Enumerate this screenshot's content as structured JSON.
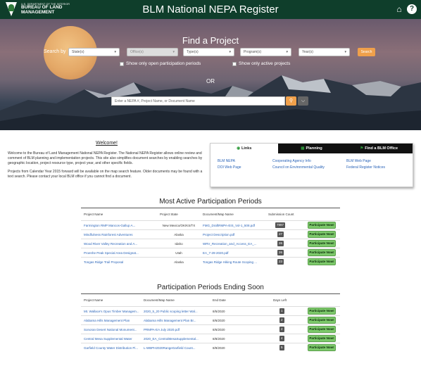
{
  "header": {
    "logo_line1": "U.S. DEPARTMENT OF THE INTERIOR",
    "logo_line2": "BUREAU OF LAND",
    "logo_line3": "MANAGEMENT",
    "title": "BLM National NEPA Register",
    "icons": [
      "home-icon",
      "help-icon"
    ]
  },
  "hero": {
    "title": "Find a Project",
    "search_by_label": "Search by",
    "filters": [
      {
        "label": "State(s)",
        "disabled": false
      },
      {
        "label": "Office(s)",
        "disabled": true
      },
      {
        "label": "Type(s)",
        "disabled": false
      },
      {
        "label": "Program(s)",
        "disabled": false
      },
      {
        "label": "Year(s)",
        "disabled": false
      }
    ],
    "search_button": "Search",
    "checkbox_open": "Show only open participation periods",
    "checkbox_active": "Show only active projects",
    "or_label": "OR",
    "keyword_placeholder": "Enter a NEPA #, Project Name, or Document Name"
  },
  "welcome": {
    "title": "Welcome!",
    "paragraph1": "Welcome to the Bureau of Land Management National NEPA Register. The National NEPA Register allows online review and comment of BLM planning and implementation projects. This site also simplifies document searches by enabling searches by geographic location, project resource type, project year, and other specific fields.",
    "paragraph2": "Projects from Calendar Year 2015 forward will be available on the map search feature. Older documents may be found with a text search. Please contact your local BLM office if you cannot find a document."
  },
  "links_panel": {
    "tabs": [
      {
        "label": "Links",
        "active": true
      },
      {
        "label": "Planning",
        "active": false
      },
      {
        "label": "Find a BLM Office",
        "active": false
      }
    ],
    "links": [
      "BLM NEPA",
      "Cooperating Agency Info",
      "BLM Web Page",
      "DOI Web Page",
      "Council on Environmental Quality",
      "Federal Register Notices"
    ]
  },
  "active_periods": {
    "title": "Most Active Participation Periods",
    "headers": [
      "Project Name",
      "Project State",
      "Document/Map Name",
      "Submission Count"
    ],
    "button_label": "Participate Now!",
    "rows": [
      {
        "project": "Farmington RMP Mancos-Gallup A...",
        "state": "New Mexico/OK/KS/TX",
        "document": "FMG_DraftRMPA-EIS_Vol-1_508.pdf",
        "count": "7997"
      },
      {
        "project": "Mindfulness Rainforest Adventures",
        "state": "Alaska",
        "document": "Project Description.pdf",
        "count": "27"
      },
      {
        "project": "Wood River Valley Recreation and A...",
        "state": "Idaho",
        "document": "WRV_Recreation_and_Access_EA_...",
        "count": "26"
      },
      {
        "project": "Proenhe Peak Special Area Designat...",
        "state": "Utah",
        "document": "EA_7-29-2020.pdf",
        "count": "26"
      },
      {
        "project": "Tongas Ridge Trail Proposal",
        "state": "Alaska",
        "document": "Tongas Ridge Hiking Route Scoping ...",
        "count": "23"
      }
    ]
  },
  "ending_soon": {
    "title": "Participation Periods Ending Soon",
    "headers": [
      "Project Name",
      "Document/Map Name",
      "End Date",
      "Days Left"
    ],
    "button_label": "Participate Now!",
    "rows": [
      {
        "project": "Mt. Wallace's Opus Timber Managem...",
        "document": "2020_5_20 Public scoping letter Wal...",
        "end_date": "8/5/2020",
        "days": "1"
      },
      {
        "project": "Alabama Hills Management Plan",
        "document": "Alabama Hills Management Plan Br...",
        "end_date": "8/6/2020",
        "days": "2"
      },
      {
        "project": "Sonoran Desert National Monument...",
        "document": "PRMPA-EA July 2020.pdf",
        "end_date": "8/6/2020",
        "days": "2"
      },
      {
        "project": "Central Mesa Supplemental Water",
        "document": "2020_EA_CentralMesaSupplemental...",
        "end_date": "8/8/2020",
        "days": "4"
      },
      {
        "project": "Garfield County Water Distribution Pi...",
        "document": "L-WBPH2020RangeGarfield Count...",
        "end_date": "8/9/2020",
        "days": "5"
      }
    ]
  }
}
